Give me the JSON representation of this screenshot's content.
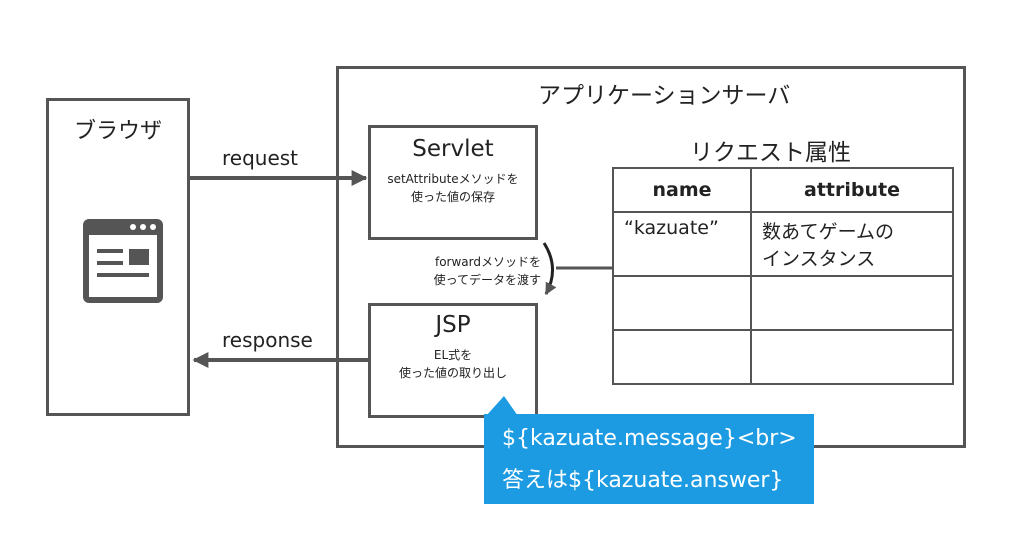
{
  "browser": {
    "title": "ブラウザ",
    "icon": "browser-window-icon"
  },
  "app_server": {
    "title": "アプリケーションサーバ"
  },
  "servlet": {
    "name": "Servlet",
    "desc_line1": "setAttributeメソッドを",
    "desc_line2": "使った値の保存"
  },
  "jsp": {
    "name": "JSP",
    "desc_line1": "EL式を",
    "desc_line2": "使った値の取り出し"
  },
  "forward": {
    "line1": "forwardメソッドを",
    "line2": "使ってデータを渡す"
  },
  "arrows": {
    "request": "request",
    "response": "response"
  },
  "attributes": {
    "title": "リクエスト属性",
    "headers": [
      "name",
      "attribute"
    ],
    "rows": [
      {
        "name": "“kazuate”",
        "value_line1": "数あてゲームの",
        "value_line2": "インスタンス"
      },
      {
        "name": "",
        "value_line1": "",
        "value_line2": ""
      },
      {
        "name": "",
        "value_line1": "",
        "value_line2": ""
      }
    ]
  },
  "callout": {
    "line1": "${kazuate.message}<br>",
    "line2": "答えは${kazuate.answer}"
  },
  "colors": {
    "line": "#555555",
    "callout": "#1c9be2"
  }
}
